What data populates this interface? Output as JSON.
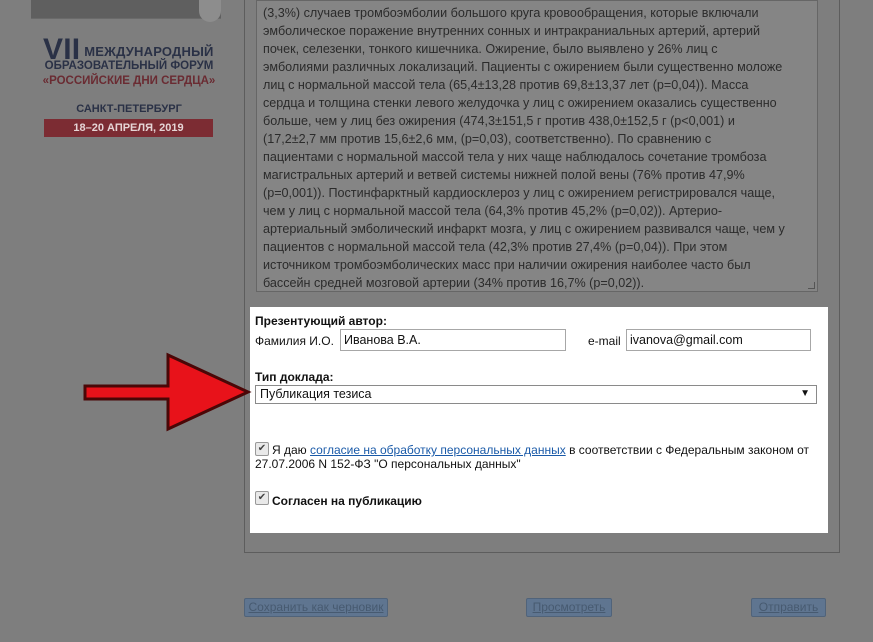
{
  "banner": {
    "vii": "VII",
    "line1": "МЕЖДУНАРОДНЫЙ",
    "line2": "ОБРАЗОВАТЕЛЬНЫЙ ФОРУМ",
    "line3": "«РОССИЙСКИЕ ДНИ СЕРДЦА»",
    "city": "САНКТ-ПЕТЕРБУРГ",
    "dates": "18–20 АПРЕЛЯ, 2019"
  },
  "abstract": {
    "lines": [
      "(3,3%) случаев тромбоэмболии большого круга кровообращения, которые включали",
      "эмболическое поражение внутренних сонных и интракраниальных артерий, артерий",
      "почек, селезенки, тонкого кишечника. Ожирение, было выявлено у 26% лиц с",
      "эмболиями различных локализаций. Пациенты с ожирением были существенно моложе",
      "лиц с нормальной массой тела (65,4±13,28 против 69,8±13,37 лет (p=0,04)). Масса",
      "сердца и толщина стенки левого желудочка у лиц с ожирением оказались существенно",
      "больше, чем у лиц без ожирения (474,3±151,5 г против 438,0±152,5 г (p<0,001) и",
      "(17,2±2,7 мм против 15,6±2,6 мм, (p=0,03), соответственно). По сравнению с",
      "пациентами с нормальной массой тела у них чаще наблюдалось сочетание тромбоза",
      "магистральных артерий и ветвей системы нижней полой вены (76% против 47,9%",
      "(p=0,001)). Постинфарктный кардиосклероз у лиц с ожирением регистрировался чаще,",
      "чем у лиц с нормальной массой тела (64,3% против 45,2% (p=0,02)). Артерио-",
      "артериальный эмболический инфаркт мозга, у лиц с ожирением развивался чаще, чем у",
      "пациентов с нормальной массой тела (42,3% против 27,4% (p=0,04)). При этом",
      "источником тромбоэмболических масс при наличии ожирения наиболее часто был",
      "бассейн средней мозговой артерии (34% против 16,7% (p=0,02))."
    ]
  },
  "form": {
    "presenter_heading": "Презентующий автор:",
    "name_label": "Фамилия И.О.",
    "name_value": "Иванова В.А.",
    "email_label": "e-mail",
    "email_value": "ivanova@gmail.com",
    "report_type_label": "Тип доклада:",
    "report_type_value": "Публикация тезиса",
    "consent_text_before": "Я даю",
    "consent_link": "согласие на обработку персональных данных",
    "consent_text_after": "в соответствии с Федеральным законом от 27.07.2006 N 152-ФЗ \"О персональных данных\"",
    "consent_checked": true,
    "publish_label": "Согласен на публикацию",
    "publish_checked": true
  },
  "buttons": {
    "save_draft": "Сохранить как черновик",
    "preview": "Просмотреть",
    "submit": "Отправить"
  },
  "colors": {
    "overlay": "#7e7e7e",
    "arrow": "#e8121a",
    "link": "#1a5aa8"
  }
}
